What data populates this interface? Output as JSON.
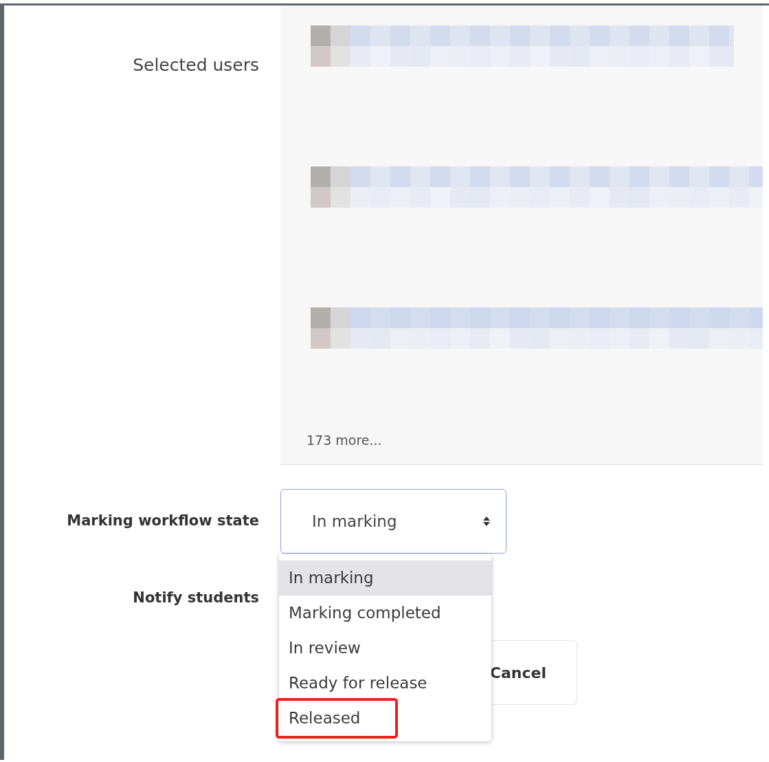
{
  "selected_users": {
    "label": "Selected users",
    "entries": [
      {
        "kind": "redacted",
        "cut_off": false
      },
      {
        "kind": "redacted",
        "cut_off": true
      },
      {
        "kind": "redacted",
        "cut_off": true
      }
    ],
    "more": "173 more..."
  },
  "marking_workflow_state": {
    "label": "Marking workflow state",
    "value": "In marking",
    "expanded": true,
    "options": [
      {
        "label": "In marking",
        "selected": true,
        "annotated": false
      },
      {
        "label": "Marking completed",
        "selected": false,
        "annotated": false
      },
      {
        "label": "In review",
        "selected": false,
        "annotated": false
      },
      {
        "label": "Ready for release",
        "selected": false,
        "annotated": false
      },
      {
        "label": "Released",
        "selected": false,
        "annotated": true
      }
    ]
  },
  "notify_students": {
    "label": "Notify students"
  },
  "buttons": [
    {
      "label": "Cancel"
    }
  ]
}
